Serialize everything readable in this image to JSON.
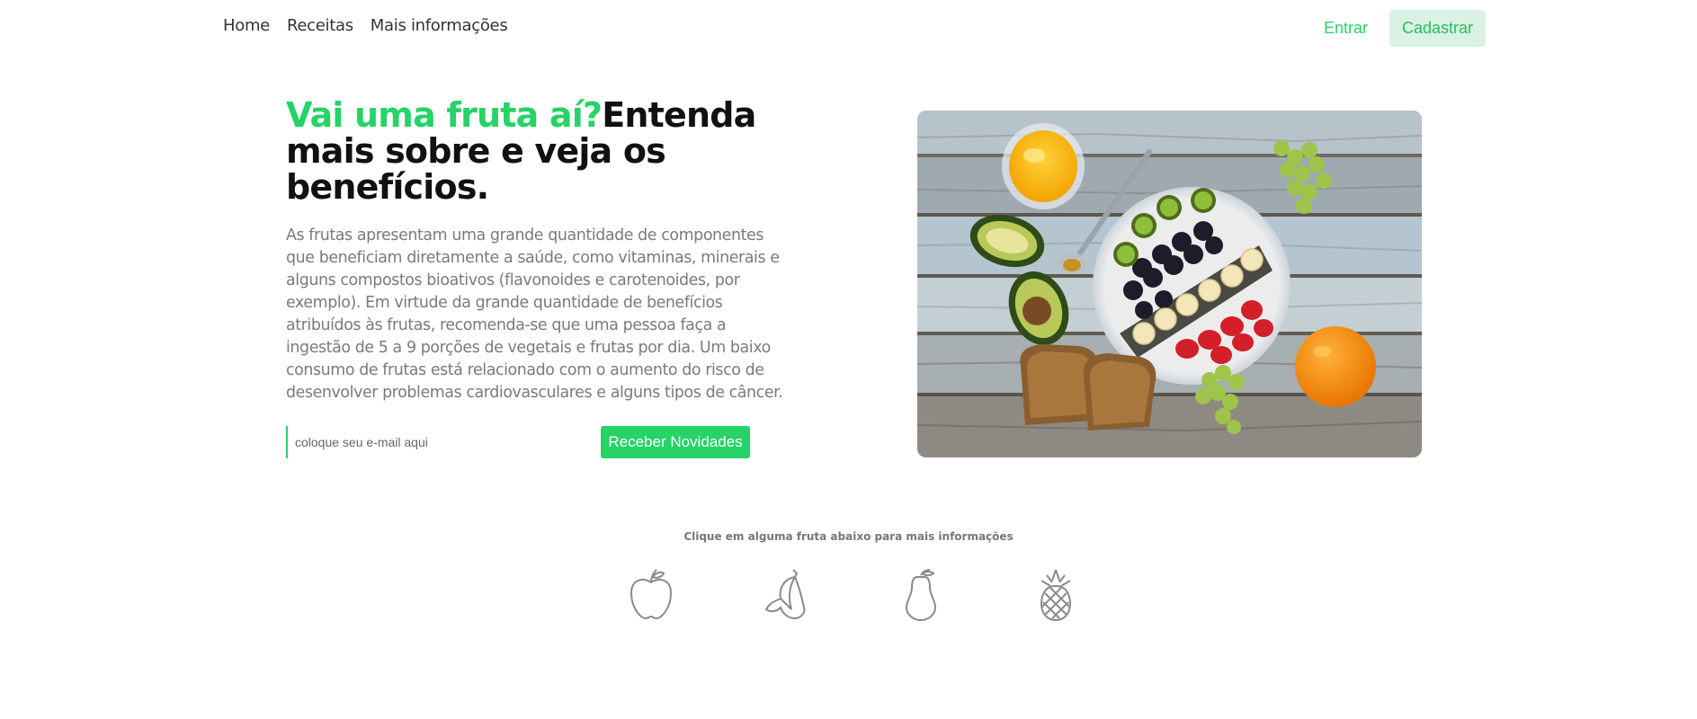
{
  "nav": {
    "links": [
      "Home",
      "Receitas",
      "Mais informações"
    ],
    "login_label": "Entrar",
    "signup_label": "Cadastrar"
  },
  "hero": {
    "title_accent": "Vai uma fruta aí?",
    "title_rest": "Entenda mais sobre e veja os benefícios.",
    "description": "As frutas apresentam uma grande quantidade de componentes que beneficiam diretamente a saúde, como vitaminas, minerais e alguns compostos bioativos (flavonoides e carotenoides, por exemplo). Em virtude da grande quantidade de benefícios atribuídos às frutas, recomenda-se que uma pessoa faça a ingestão de 5 a 9 porções de vegetais e frutas por dia. Um baixo consumo de frutas está relacionado com o aumento do risco de desenvolver problemas cardiovasculares e alguns tipos de câncer.",
    "email_placeholder": "coloque seu e-mail aqui",
    "subscribe_label": "Receber Novidades"
  },
  "fruits": {
    "caption": "Clique em alguma fruta abaixo para mais informações",
    "icons": [
      "apple-icon",
      "banana-icon",
      "pear-icon",
      "pineapple-icon"
    ]
  },
  "colors": {
    "accent": "#25d366",
    "accent_light": "#d9f2e3",
    "text_muted": "#7a7a7a",
    "icon_gray": "#8a8a8a"
  }
}
